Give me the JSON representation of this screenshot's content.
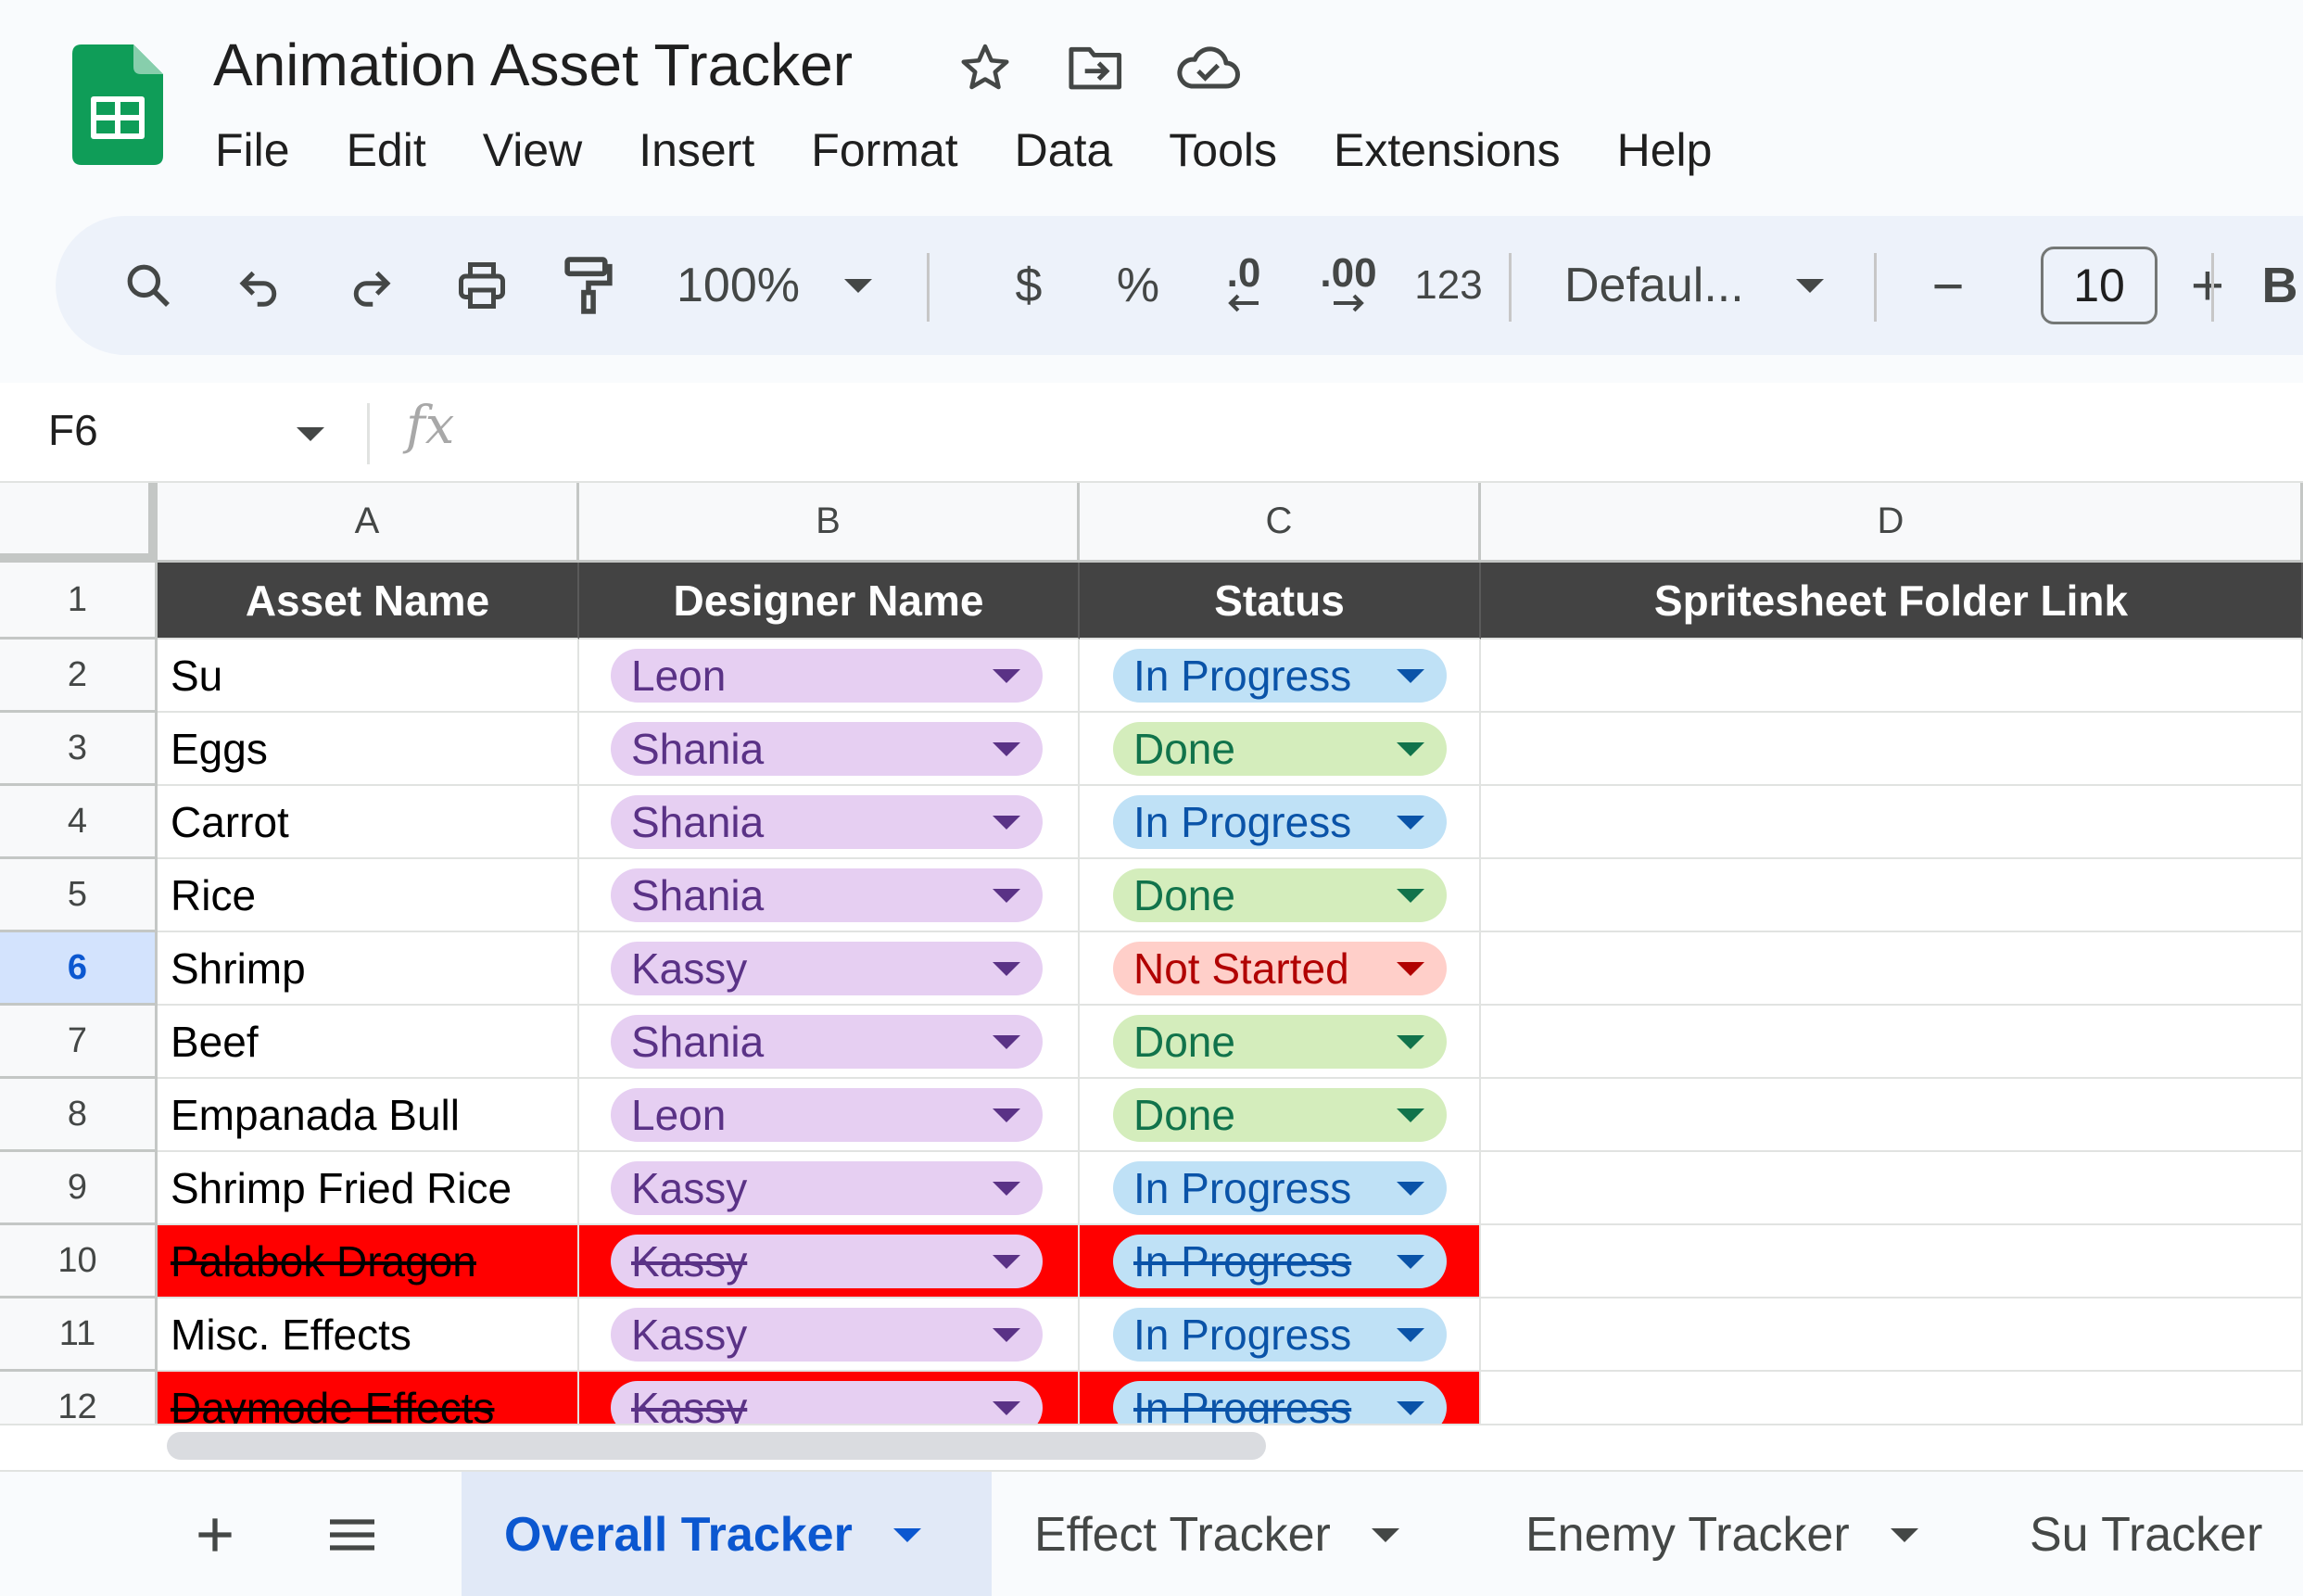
{
  "app": {
    "title": "Animation Asset Tracker",
    "menu": [
      "File",
      "Edit",
      "View",
      "Insert",
      "Format",
      "Data",
      "Tools",
      "Extensions",
      "Help"
    ]
  },
  "toolbar": {
    "zoom": "100%",
    "currency": "$",
    "percent": "%",
    "decrease_decimal": ".0",
    "increase_decimal": ".00",
    "number_format": "123",
    "font": "Defaul...",
    "font_size": "10",
    "minus": "−",
    "plus": "+",
    "bold": "B"
  },
  "formula_bar": {
    "name_box": "F6",
    "fx": "fx"
  },
  "columns": [
    "A",
    "B",
    "C",
    "D"
  ],
  "header_row": [
    "Asset Name",
    "Designer Name",
    "Status",
    "Spritesheet Folder Link"
  ],
  "rows": [
    {
      "n": "1"
    },
    {
      "n": "2",
      "asset": "Su",
      "designer": "Leon",
      "status": "In Progress"
    },
    {
      "n": "3",
      "asset": "Eggs",
      "designer": "Shania",
      "status": "Done"
    },
    {
      "n": "4",
      "asset": "Carrot",
      "designer": "Shania",
      "status": "In Progress"
    },
    {
      "n": "5",
      "asset": "Rice",
      "designer": "Shania",
      "status": "Done"
    },
    {
      "n": "6",
      "asset": "Shrimp",
      "designer": "Kassy",
      "status": "Not Started"
    },
    {
      "n": "7",
      "asset": "Beef",
      "designer": "Shania",
      "status": "Done"
    },
    {
      "n": "8",
      "asset": "Empanada Bull",
      "designer": "Leon",
      "status": "Done"
    },
    {
      "n": "9",
      "asset": "Shrimp Fried Rice",
      "designer": "Kassy",
      "status": "In Progress"
    },
    {
      "n": "10",
      "asset": "Palabok Dragon",
      "designer": "Kassy",
      "status": "In Progress"
    },
    {
      "n": "11",
      "asset": "Misc. Effects",
      "designer": "Kassy",
      "status": "In Progress"
    },
    {
      "n": "12",
      "asset": "Daymode Effects",
      "designer": "Kassy",
      "status": "In Progress"
    }
  ],
  "sheet_tabs": {
    "add": "+",
    "tabs": [
      "Overall Tracker",
      "Effect Tracker",
      "Enemy Tracker",
      "Su Tracker"
    ]
  },
  "colors": {
    "sheets_green": "#0f9d58",
    "header_dark": "#434343",
    "strike_red": "#ff0000",
    "designer_chip": "#e6cff2",
    "progress_chip": "#bfe1f6",
    "done_chip": "#d4edbc",
    "notstarted_chip": "#ffcfc9",
    "active_tab": "#0b57d0"
  }
}
